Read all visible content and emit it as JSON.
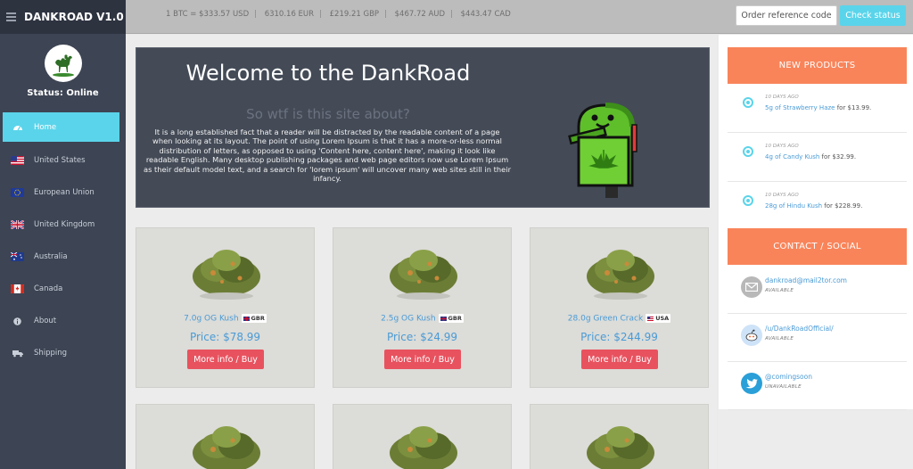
{
  "brand": {
    "title": "DANKROAD V1.0"
  },
  "sidebar": {
    "status": "Status: Online",
    "items": [
      {
        "label": "Home",
        "icon": "dashboard-icon",
        "active": true
      },
      {
        "label": "United States",
        "icon": "us-flag-icon"
      },
      {
        "label": "European Union",
        "icon": "eu-flag-icon"
      },
      {
        "label": "United Kingdom",
        "icon": "uk-flag-icon"
      },
      {
        "label": "Australia",
        "icon": "au-flag-icon"
      },
      {
        "label": "Canada",
        "icon": "ca-flag-icon"
      },
      {
        "label": "About",
        "icon": "info-icon"
      },
      {
        "label": "Shipping",
        "icon": "truck-icon"
      }
    ]
  },
  "topbar": {
    "rates": [
      "1 BTC = $333.57 USD",
      "6310.16 EUR",
      "£219.21 GBP",
      "$467.72 AUD",
      "$443.47 CAD"
    ],
    "order_ref_placeholder": "Order reference code",
    "check_status": "Check status"
  },
  "hero": {
    "title": "Welcome to the DankRoad",
    "subtitle": "So wtf is this site about?",
    "text": "It is a long established fact that a reader will be distracted by the readable content of a page when looking at its layout. The point of using Lorem Ipsum is that it has a more-or-less normal distribution of letters, as opposed to using 'Content here, content here', making it look like readable English. Many desktop publishing packages and web page editors now use Lorem Ipsum as their default model text, and a search for 'lorem ipsum' will uncover many web sites still in their infancy."
  },
  "products": [
    {
      "name": "7.0g OG Kush",
      "origin": "GBR",
      "price": "Price: $78.99",
      "button": "More info / Buy"
    },
    {
      "name": "2.5g OG Kush",
      "origin": "GBR",
      "price": "Price: $24.99",
      "button": "More info / Buy"
    },
    {
      "name": "28.0g Green Crack",
      "origin": "USA",
      "price": "Price: $244.99",
      "button": "More info / Buy"
    }
  ],
  "new_products": {
    "heading": "NEW PRODUCTS",
    "items": [
      {
        "ago": "10 DAYS AGO",
        "link": "5g of Strawberry Haze",
        "suffix": " for $13.99."
      },
      {
        "ago": "10 DAYS AGO",
        "link": "4g of Candy Kush",
        "suffix": " for $32.99."
      },
      {
        "ago": "10 DAYS AGO",
        "link": "28g of Hindu Kush",
        "suffix": " for $228.99."
      }
    ]
  },
  "contact": {
    "heading": "CONTACT / SOCIAL",
    "items": [
      {
        "link": "dankroad@mail2tor.com",
        "status": "AVAILABLE",
        "icon": "mail-icon"
      },
      {
        "link": "/u/DankRoadOfficial/",
        "status": "AVAILABLE",
        "icon": "reddit-icon"
      },
      {
        "link": "@comingsoon",
        "status": "UNAVAILABLE",
        "icon": "twitter-icon"
      }
    ]
  },
  "colors": {
    "accent": "#5ad4ea",
    "orange": "#f9845a",
    "buy": "#e8525f",
    "sidebar": "#3d4453"
  }
}
